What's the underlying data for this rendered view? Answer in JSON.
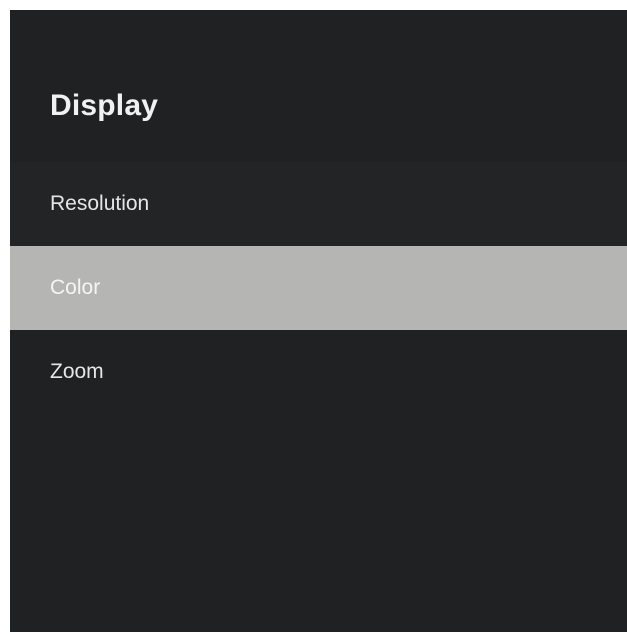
{
  "screen": {
    "title": "Display"
  },
  "menu": {
    "items": [
      {
        "label": "Resolution",
        "selected": false
      },
      {
        "label": "Color",
        "selected": true
      },
      {
        "label": "Zoom",
        "selected": false
      }
    ]
  },
  "colors": {
    "background": "#202123",
    "selected_background": "#b5b6b4",
    "text": "#e6e6e6",
    "title": "#f1f1f1"
  }
}
